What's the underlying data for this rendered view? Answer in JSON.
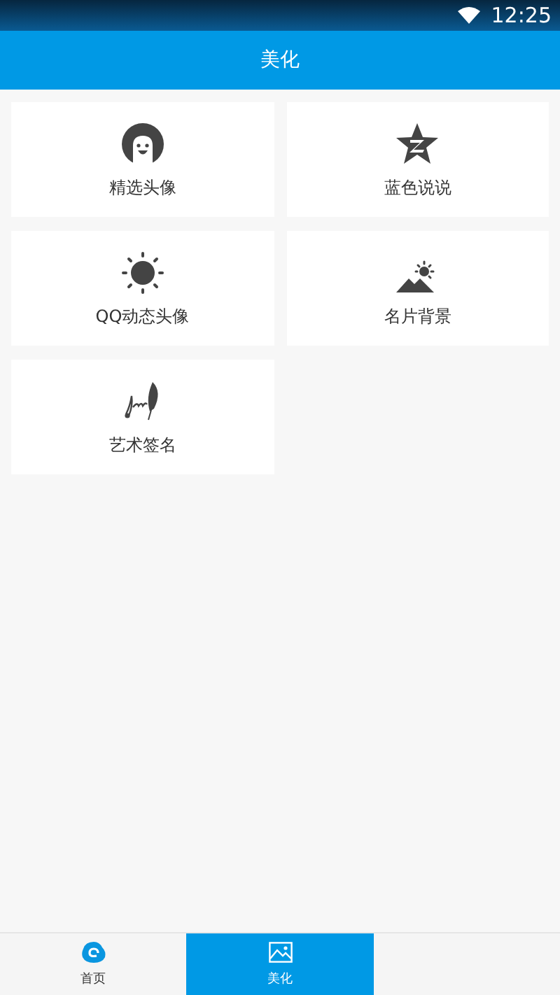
{
  "status_bar": {
    "time": "12:25"
  },
  "header": {
    "title": "美化"
  },
  "grid": {
    "items": [
      {
        "label": "精选头像",
        "kind": "avatar"
      },
      {
        "label": "蓝色说说",
        "kind": "star"
      },
      {
        "label": "QQ动态头像",
        "kind": "sun"
      },
      {
        "label": "名片背景",
        "kind": "mountain"
      },
      {
        "label": "艺术签名",
        "kind": "feather"
      }
    ]
  },
  "bottom_nav": {
    "tabs": [
      {
        "label": "首页",
        "kind": "home",
        "selected": false
      },
      {
        "label": "美化",
        "kind": "image",
        "selected": true
      }
    ]
  }
}
